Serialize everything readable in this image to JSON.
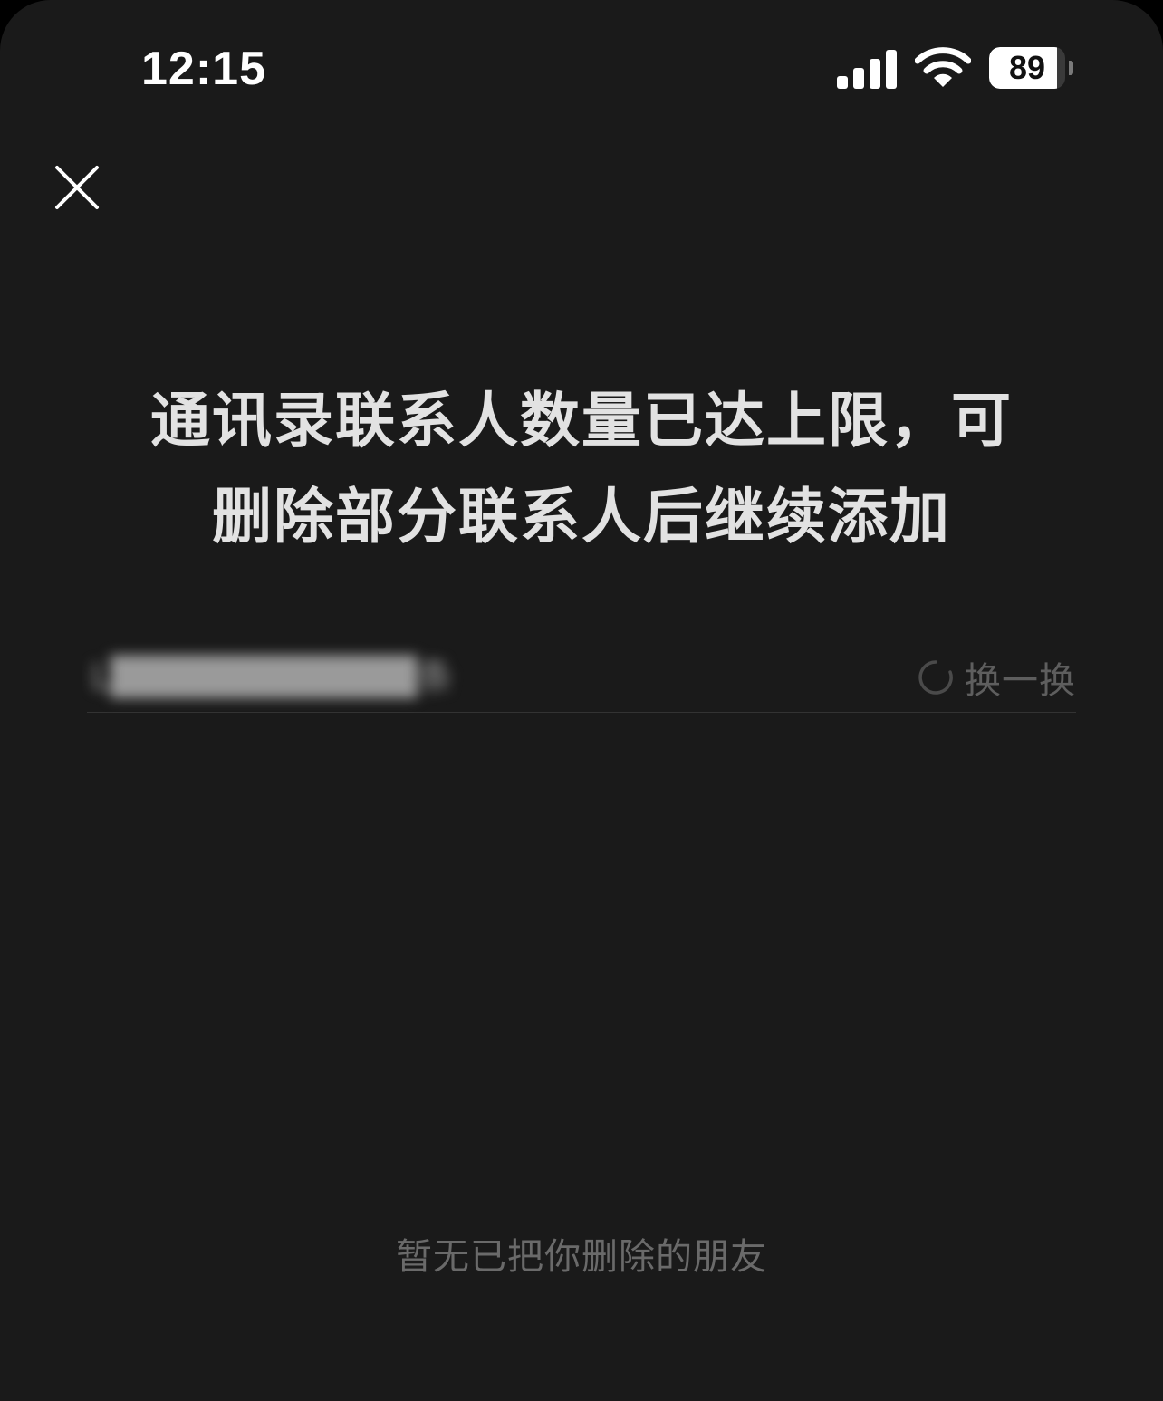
{
  "status_bar": {
    "time": "12:15",
    "battery_level": "89",
    "battery_fraction": 0.89,
    "signal_icon": "cellular-signal-icon",
    "wifi_icon": "wifi-icon"
  },
  "header": {
    "close_icon": "close-icon"
  },
  "message": {
    "line1": "通讯录联系人数量已达上限，可",
    "line2": "删除部分联系人后继续添加"
  },
  "suggestion": {
    "blurred_text": "L███████████条",
    "refresh_icon": "refresh-icon",
    "refresh_label": "换一换"
  },
  "empty_state": {
    "text": "暂无已把你删除的朋友"
  },
  "colors": {
    "background": "#1a1a1a",
    "headline": "#e2e2e2",
    "muted": "#5e5e5e",
    "divider": "#333333"
  }
}
